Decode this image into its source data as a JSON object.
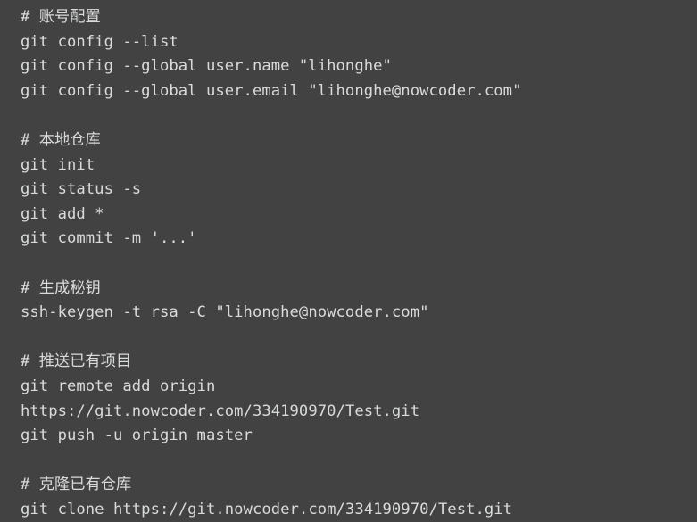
{
  "document": {
    "kind": "code-snippet",
    "language": "shell",
    "colors": {
      "background": "#424242",
      "text": "#d9dadb",
      "comment": "#d9dadb"
    },
    "lines": [
      {
        "text": "# 账号配置",
        "type": "comment"
      },
      {
        "text": "git config --list",
        "type": "code"
      },
      {
        "text": "git config --global user.name \"lihonghe\"",
        "type": "code"
      },
      {
        "text": "git config --global user.email \"lihonghe@nowcoder.com\"",
        "type": "code"
      },
      {
        "text": "",
        "type": "blank"
      },
      {
        "text": "# 本地仓库",
        "type": "comment"
      },
      {
        "text": "git init",
        "type": "code"
      },
      {
        "text": "git status -s",
        "type": "code"
      },
      {
        "text": "git add *",
        "type": "code"
      },
      {
        "text": "git commit -m '...'",
        "type": "code"
      },
      {
        "text": "",
        "type": "blank"
      },
      {
        "text": "# 生成秘钥",
        "type": "comment"
      },
      {
        "text": "ssh-keygen -t rsa -C \"lihonghe@nowcoder.com\"",
        "type": "code"
      },
      {
        "text": "",
        "type": "blank"
      },
      {
        "text": "# 推送已有项目",
        "type": "comment"
      },
      {
        "text": "git remote add origin",
        "type": "code"
      },
      {
        "text": "https://git.nowcoder.com/334190970/Test.git",
        "type": "code"
      },
      {
        "text": "git push -u origin master",
        "type": "code"
      },
      {
        "text": "",
        "type": "blank"
      },
      {
        "text": "# 克隆已有仓库",
        "type": "comment"
      },
      {
        "text": "git clone https://git.nowcoder.com/334190970/Test.git",
        "type": "code"
      }
    ]
  }
}
